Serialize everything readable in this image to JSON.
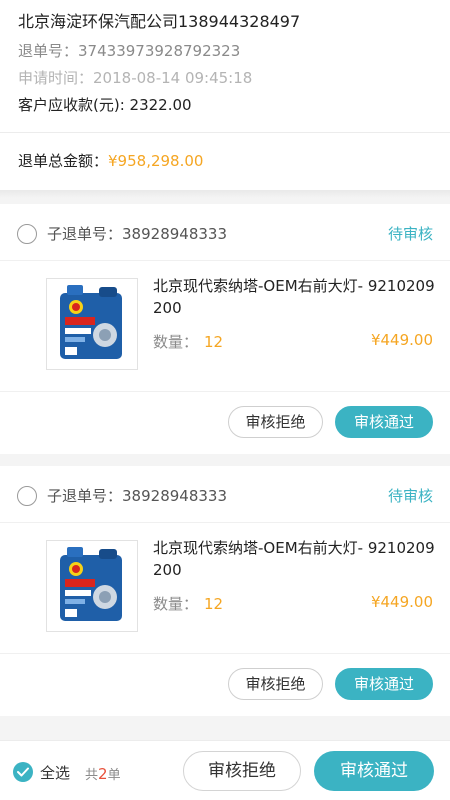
{
  "header": {
    "company": "北京海淀环保汽配公司138944328497",
    "return_no_label": "退单号：",
    "return_no": "37433973928792323",
    "apply_time_label": "申请时间：",
    "apply_time": "2018-08-14 09:45:18",
    "receivable_label": "客户应收款(元):",
    "receivable": "2322.00",
    "total_label": "退单总金额：",
    "total_amount": "¥958,298.00"
  },
  "cards": [
    {
      "sub_label": "子退单号：",
      "sub_no": "38928948333",
      "status": "待审核",
      "product_name": "北京现代索纳塔-OEM右前大灯- 9210209200",
      "qty_label": "数量：",
      "qty": "12",
      "price": "¥449.00",
      "reject": "审核拒绝",
      "approve": "审核通过"
    },
    {
      "sub_label": "子退单号：",
      "sub_no": "38928948333",
      "status": "待审核",
      "product_name": "北京现代索纳塔-OEM右前大灯- 9210209200",
      "qty_label": "数量：",
      "qty": "12",
      "price": "¥449.00",
      "reject": "审核拒绝",
      "approve": "审核通过"
    }
  ],
  "bottom": {
    "select_all": "全选",
    "count_prefix": "共",
    "count": "2",
    "count_suffix": "单",
    "reject": "审核拒绝",
    "approve": "审核通过"
  },
  "colors": {
    "accent": "#3bb3c3",
    "price": "#f5a623",
    "count": "#e8503a"
  },
  "icons": {
    "radio": "radio-unchecked-icon",
    "check": "checkmark-icon",
    "product": "shell-helix-oil-product-image"
  }
}
